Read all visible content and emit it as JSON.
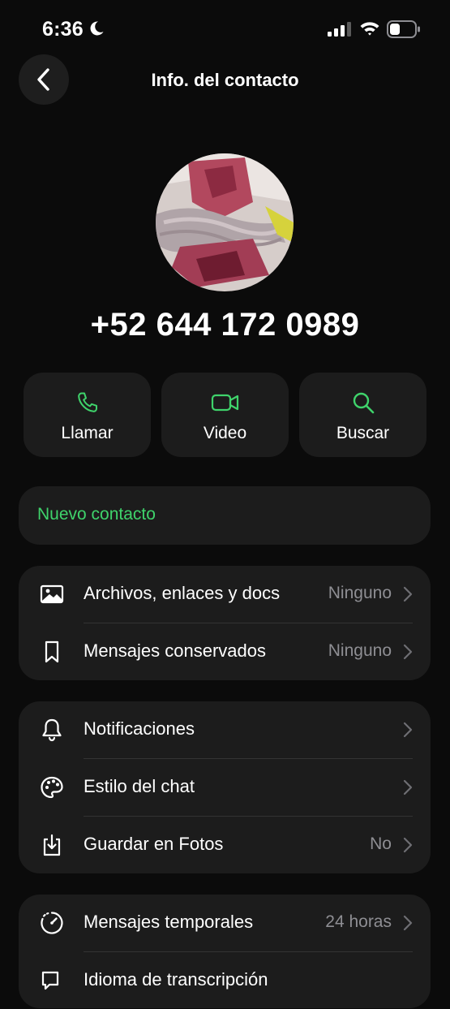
{
  "status": {
    "time": "6:36"
  },
  "nav": {
    "title": "Info. del contacto"
  },
  "contact": {
    "phone": "+52 644 172 0989"
  },
  "actions": [
    {
      "label": "Llamar",
      "icon": "phone-icon"
    },
    {
      "label": "Video",
      "icon": "video-icon"
    },
    {
      "label": "Buscar",
      "icon": "search-icon"
    }
  ],
  "new_contact": {
    "label": "Nuevo contacto"
  },
  "group1": [
    {
      "label": "Archivos, enlaces y docs",
      "value": "Ninguno",
      "icon": "photo-icon"
    },
    {
      "label": "Mensajes conservados",
      "value": "Ninguno",
      "icon": "bookmark-icon"
    }
  ],
  "group2": [
    {
      "label": "Notificaciones",
      "value": "",
      "icon": "bell-icon"
    },
    {
      "label": "Estilo del chat",
      "value": "",
      "icon": "palette-icon"
    },
    {
      "label": "Guardar en Fotos",
      "value": "No",
      "icon": "download-icon"
    }
  ],
  "group3": [
    {
      "label": "Mensajes temporales",
      "value": "24 horas",
      "icon": "timer-icon"
    },
    {
      "label": "Idioma de transcripción",
      "value": "",
      "icon": "language-icon"
    }
  ],
  "colors": {
    "accent": "#3fd36b",
    "background": "#0b0b0b",
    "card": "#1c1c1c",
    "secondary_text": "#8e8e93"
  }
}
